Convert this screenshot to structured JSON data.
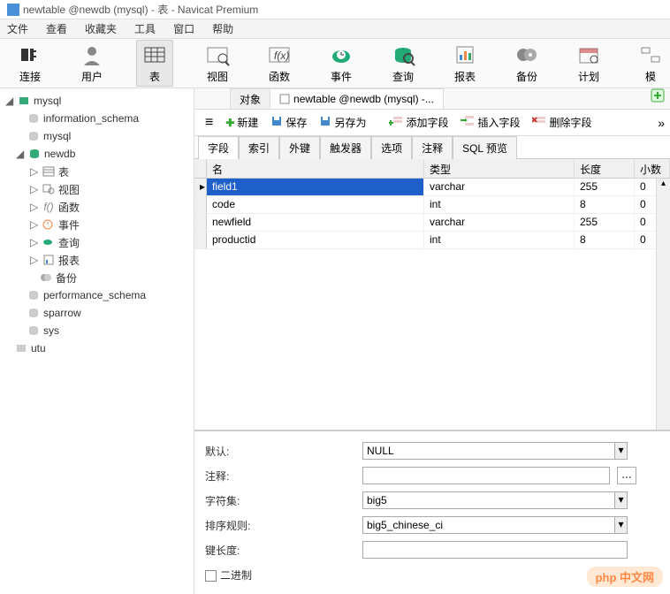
{
  "title": "newtable @newdb (mysql) - 表 - Navicat Premium",
  "menu": {
    "file": "文件",
    "view": "查看",
    "fav": "收藏夹",
    "tools": "工具",
    "window": "窗口",
    "help": "帮助"
  },
  "toolbar": {
    "connect": "连接",
    "user": "用户",
    "table": "表",
    "view": "视图",
    "func": "函数",
    "event": "事件",
    "query": "查询",
    "report": "报表",
    "backup": "备份",
    "plan": "计划",
    "model": "模"
  },
  "tree": {
    "root1": "mysql",
    "c1": "information_schema",
    "c2": "mysql",
    "db": "newdb",
    "t_table": "表",
    "t_view": "视图",
    "t_func": "函数",
    "t_event": "事件",
    "t_query": "查询",
    "t_report": "报表",
    "t_backup": "备份",
    "c3": "performance_schema",
    "c4": "sparrow",
    "c5": "sys",
    "root2": "utu"
  },
  "objtabs": {
    "objects": "对象",
    "current": "newtable @newdb (mysql) -..."
  },
  "sub": {
    "new": "新建",
    "save": "保存",
    "saveas": "另存为",
    "addfield": "添加字段",
    "insfield": "插入字段",
    "delfield": "删除字段"
  },
  "ftabs": {
    "field": "字段",
    "index": "索引",
    "fk": "外键",
    "trigger": "触发器",
    "option": "选项",
    "comment": "注释",
    "sql": "SQL 预览"
  },
  "grid": {
    "h_name": "名",
    "h_type": "类型",
    "h_len": "长度",
    "h_dec": "小数",
    "rows": [
      {
        "name": "field1",
        "type": "varchar",
        "len": "255",
        "dec": "0",
        "sel": true
      },
      {
        "name": "code",
        "type": "int",
        "len": "8",
        "dec": "0",
        "sel": false
      },
      {
        "name": "newfield",
        "type": "varchar",
        "len": "255",
        "dec": "0",
        "sel": false
      },
      {
        "name": "productid",
        "type": "int",
        "len": "8",
        "dec": "0",
        "sel": false
      }
    ]
  },
  "props": {
    "default_l": "默认:",
    "default_v": "NULL",
    "comment_l": "注释:",
    "comment_v": "",
    "charset_l": "字符集:",
    "charset_v": "big5",
    "collate_l": "排序规则:",
    "collate_v": "big5_chinese_ci",
    "keylen_l": "键长度:",
    "binary_l": "二进制"
  },
  "watermark": "php 中文网"
}
